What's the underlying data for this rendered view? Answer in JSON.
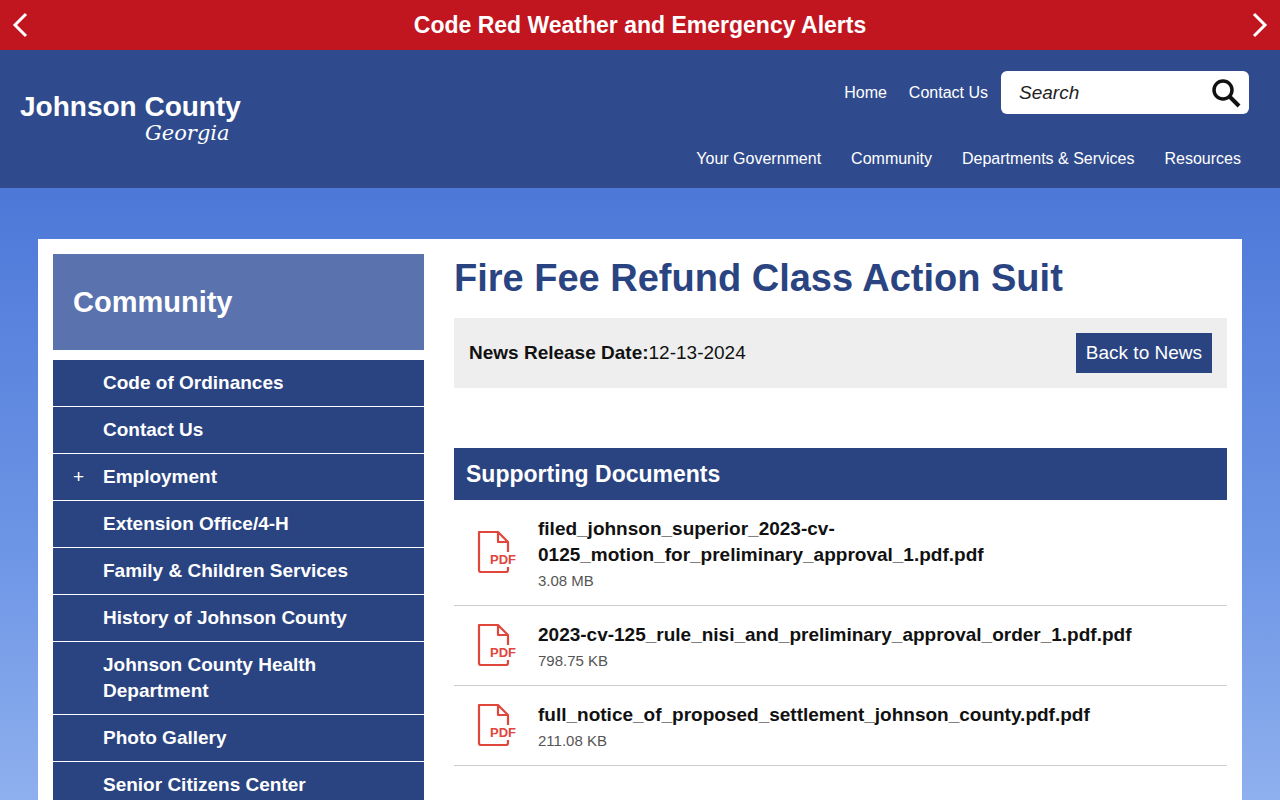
{
  "alert_bar": {
    "text": "Code Red Weather and Emergency Alerts"
  },
  "logo": {
    "name": "Johnson County",
    "state": "Georgia"
  },
  "top_links": [
    "Home",
    "Contact Us"
  ],
  "search": {
    "placeholder": "Search"
  },
  "nav": [
    "Your Government",
    "Community",
    "Departments & Services",
    "Resources"
  ],
  "sidebar": {
    "title": "Community",
    "items": [
      {
        "label": "Code of Ordinances",
        "icon": ""
      },
      {
        "label": "Contact Us",
        "icon": ""
      },
      {
        "label": "Employment",
        "icon": "+"
      },
      {
        "label": "Extension Office/4-H",
        "icon": ""
      },
      {
        "label": "Family & Children Services",
        "icon": ""
      },
      {
        "label": "History of Johnson County",
        "icon": ""
      },
      {
        "label": "Johnson County Health Department",
        "icon": ""
      },
      {
        "label": "Photo Gallery",
        "icon": ""
      },
      {
        "label": "Senior Citizens Center",
        "icon": ""
      }
    ]
  },
  "article": {
    "title": "Fire Fee Refund Class Action Suit",
    "date_label": "News Release Date:",
    "date": "12-13-2024",
    "back_button": "Back to News"
  },
  "documents": {
    "header": "Supporting Documents",
    "items": [
      {
        "name": "filed_johnson_superior_2023-cv-0125_motion_for_preliminary_approval_1.pdf.pdf",
        "size": "3.08 MB",
        "icon_label": "PDF"
      },
      {
        "name": "2023-cv-125_rule_nisi_and_preliminary_approval_order_1.pdf.pdf",
        "size": "798.75 KB",
        "icon_label": "PDF"
      },
      {
        "name": "full_notice_of_proposed_settlement_johnson_county.pdf.pdf",
        "size": "211.08 KB",
        "icon_label": "PDF"
      }
    ]
  }
}
